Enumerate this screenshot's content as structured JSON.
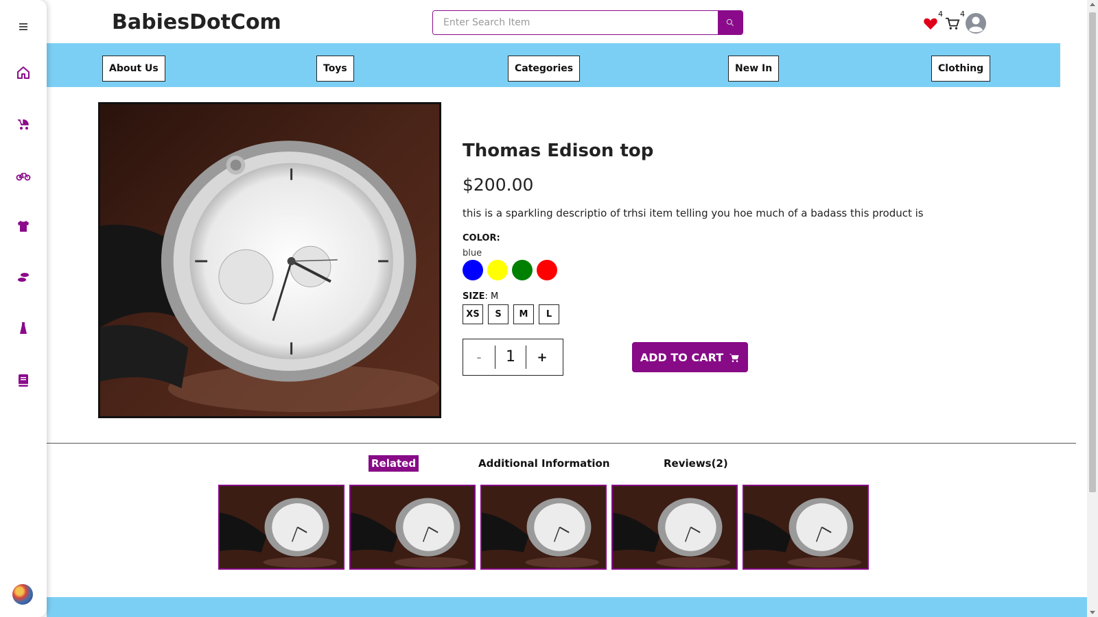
{
  "brand": "BabiesDotCom",
  "search": {
    "placeholder": "Enter Search Item"
  },
  "header": {
    "wishlist_count": "4",
    "cart_count": "4"
  },
  "nav": [
    {
      "label": "About Us"
    },
    {
      "label": "Toys"
    },
    {
      "label": "Categories"
    },
    {
      "label": "New In"
    },
    {
      "label": "Clothing"
    }
  ],
  "sidebar": {
    "icons": [
      "menu-icon",
      "home-icon",
      "stroller-icon",
      "bicycle-icon",
      "shirt-icon",
      "shoes-icon",
      "dress-icon",
      "book-icon"
    ]
  },
  "product": {
    "title": "Thomas Edison top",
    "price": "$200.00",
    "description": "this is a sparkling descriptio of trhsi item telling you hoe much of a badass this product is",
    "color_label": "COLOR",
    "color_value": "blue",
    "colors": [
      "#0000ff",
      "#ffff00",
      "#008000",
      "#ff0000"
    ],
    "size_label": "SIZE",
    "size_value": "M",
    "sizes": [
      "XS",
      "S",
      "M",
      "L"
    ],
    "quantity": "1",
    "qty_minus": "-",
    "qty_plus": "+",
    "add_to_cart": "ADD TO CART"
  },
  "tabs": [
    {
      "label": "Related",
      "active": true
    },
    {
      "label": "Additional Information",
      "active": false
    },
    {
      "label": "Reviews(2)",
      "active": false
    }
  ],
  "colors": {
    "accent": "#870a87",
    "nav_bg": "#7ccff4"
  }
}
